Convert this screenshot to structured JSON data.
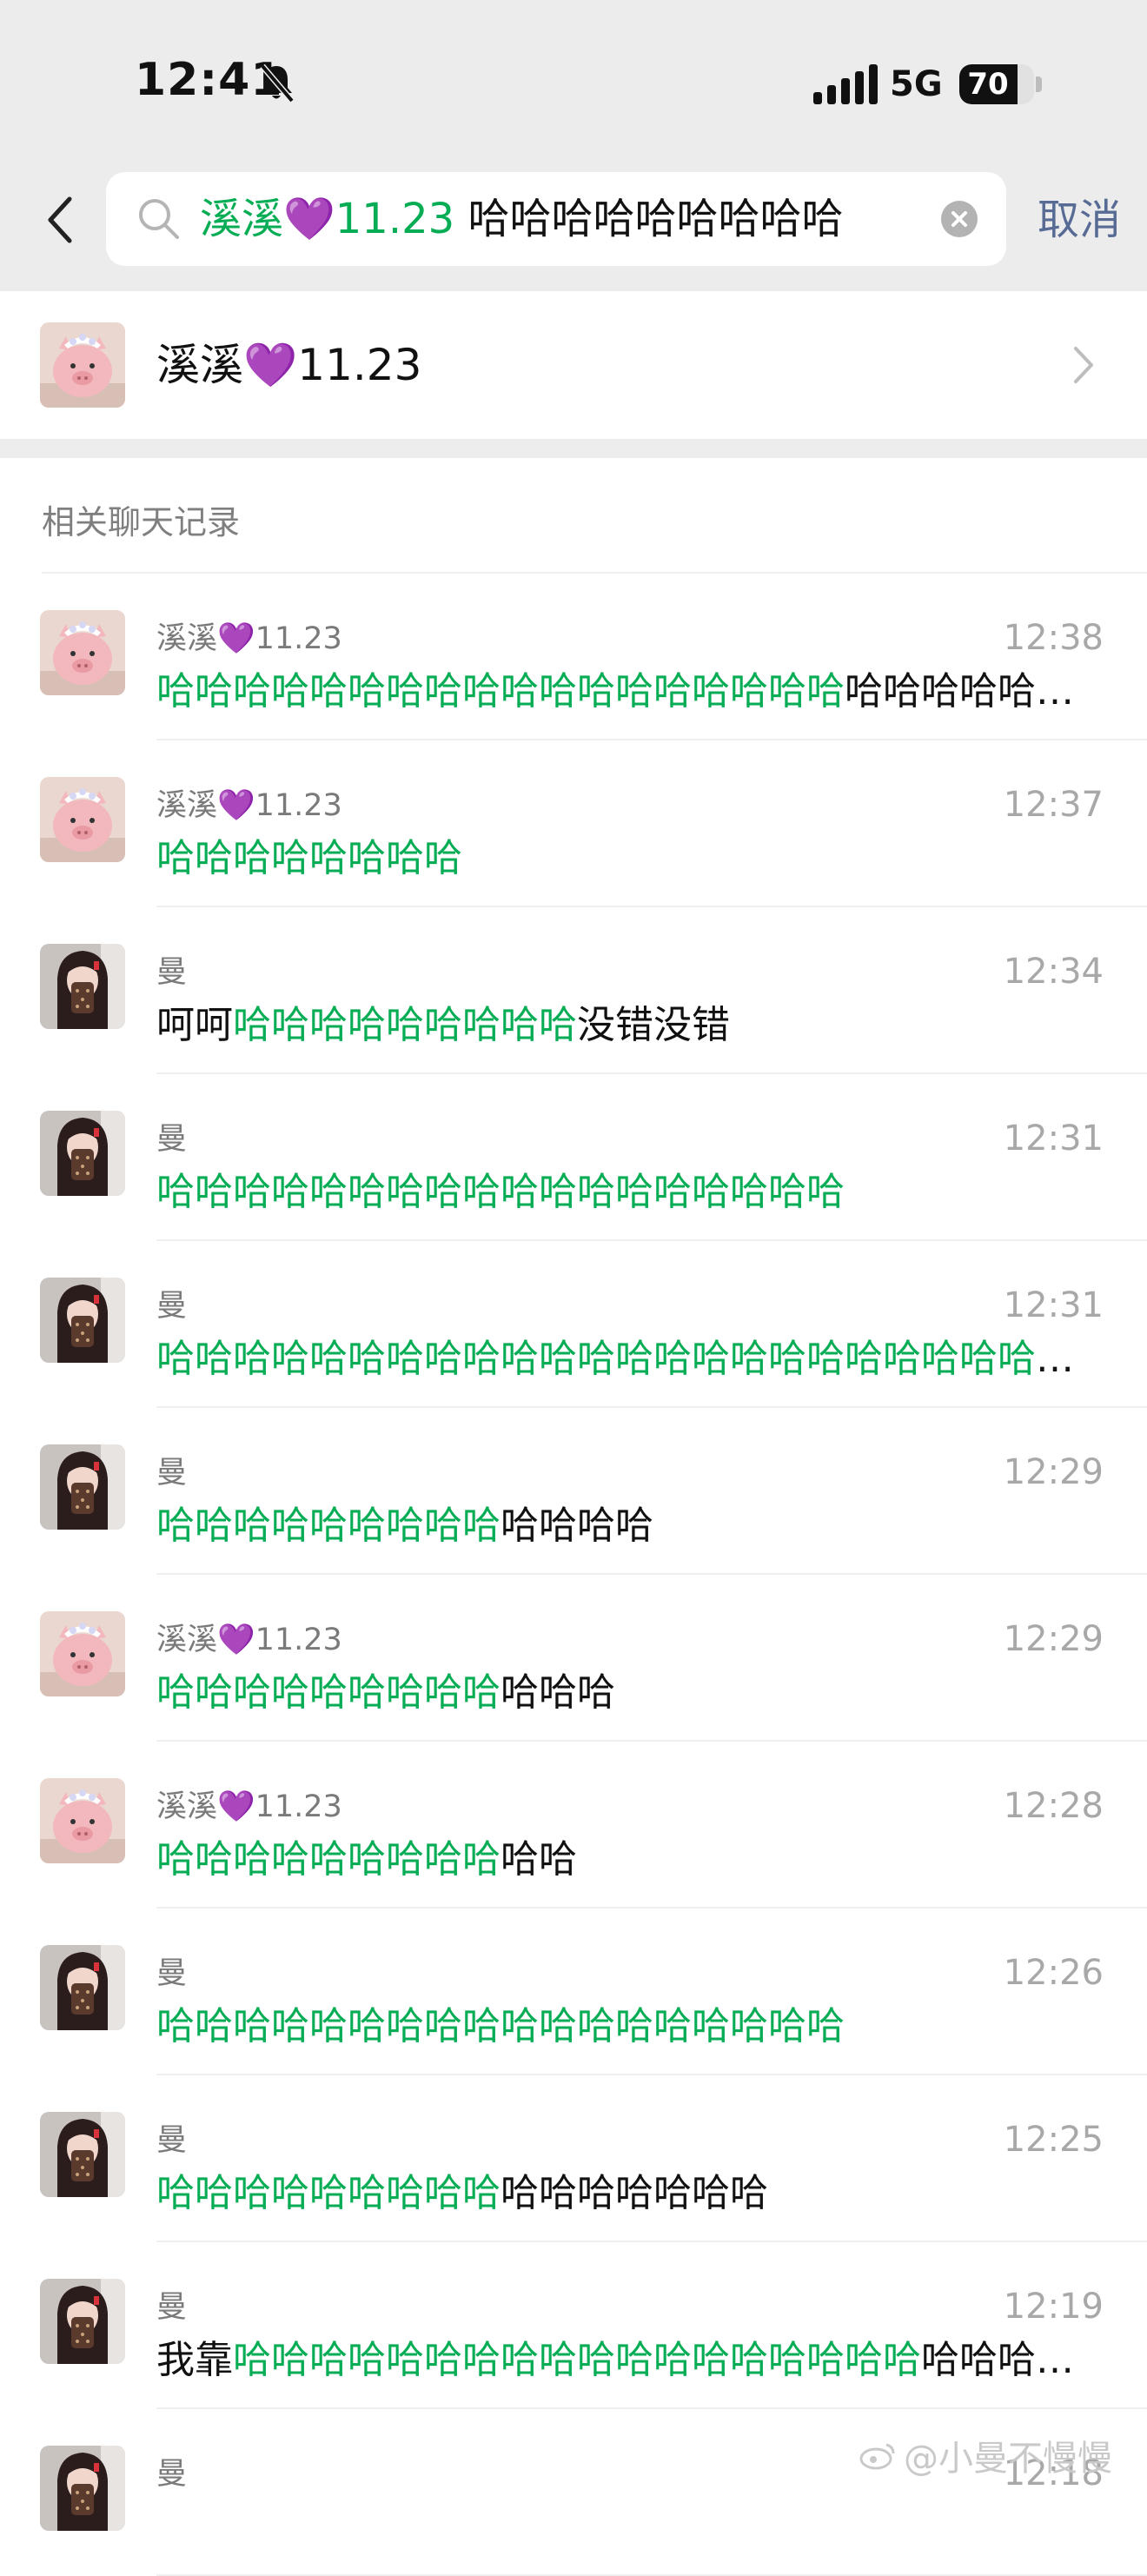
{
  "status_bar": {
    "time": "12:41",
    "network": "5G",
    "battery": "70"
  },
  "search": {
    "term": "溪溪💜11.23",
    "query_rest": "哈哈哈哈哈哈哈哈哈",
    "cancel_label": "取消"
  },
  "contact": {
    "name": "溪溪💜11.23"
  },
  "section_title": "相关聊天记录",
  "results": [
    {
      "sender": "溪溪💜11.23",
      "avatar": "pig",
      "time": "12:38",
      "pre": "",
      "hl": "哈哈哈哈哈哈哈哈哈哈哈哈哈哈哈哈哈哈",
      "post": "哈哈哈哈哈…"
    },
    {
      "sender": "溪溪💜11.23",
      "avatar": "pig",
      "time": "12:37",
      "pre": "",
      "hl": "哈哈哈哈哈哈哈哈",
      "post": ""
    },
    {
      "sender": "曼",
      "avatar": "girl",
      "time": "12:34",
      "pre": "呵呵",
      "hl": "哈哈哈哈哈哈哈哈哈",
      "post": "没错没错"
    },
    {
      "sender": "曼",
      "avatar": "girl",
      "time": "12:31",
      "pre": "",
      "hl": "哈哈哈哈哈哈哈哈哈哈哈哈哈哈哈哈哈哈",
      "post": ""
    },
    {
      "sender": "曼",
      "avatar": "girl",
      "time": "12:31",
      "pre": "",
      "hl": "哈哈哈哈哈哈哈哈哈哈哈哈哈哈哈哈哈哈哈哈哈哈哈哈…",
      "post": ""
    },
    {
      "sender": "曼",
      "avatar": "girl",
      "time": "12:29",
      "pre": "",
      "hl": "哈哈哈哈哈哈哈哈哈",
      "post": "哈哈哈哈"
    },
    {
      "sender": "溪溪💜11.23",
      "avatar": "pig",
      "time": "12:29",
      "pre": "",
      "hl": "哈哈哈哈哈哈哈哈哈",
      "post": "哈哈哈"
    },
    {
      "sender": "溪溪💜11.23",
      "avatar": "pig",
      "time": "12:28",
      "pre": "",
      "hl": "哈哈哈哈哈哈哈哈哈",
      "post": "哈哈"
    },
    {
      "sender": "曼",
      "avatar": "girl",
      "time": "12:26",
      "pre": "",
      "hl": "哈哈哈哈哈哈哈哈哈哈哈哈哈哈哈哈哈哈",
      "post": ""
    },
    {
      "sender": "曼",
      "avatar": "girl",
      "time": "12:25",
      "pre": "",
      "hl": "哈哈哈哈哈哈哈哈哈",
      "post": "哈哈哈哈哈哈哈"
    },
    {
      "sender": "曼",
      "avatar": "girl",
      "time": "12:19",
      "pre": "我靠",
      "hl": "哈哈哈哈哈哈哈哈哈哈哈哈哈哈哈哈哈哈",
      "post": "哈哈哈…"
    },
    {
      "sender": "曼",
      "avatar": "girl",
      "time": "12:18",
      "pre": "",
      "hl": "",
      "post": ""
    }
  ],
  "watermark": "@小曼不慢慢",
  "colors": {
    "highlight": "#07ad55",
    "link": "#576b95",
    "top_background": "#ececec"
  },
  "icons": [
    "back-icon",
    "search-icon",
    "clear-icon",
    "chevron-right-icon",
    "bell-off-icon",
    "weibo-icon"
  ]
}
